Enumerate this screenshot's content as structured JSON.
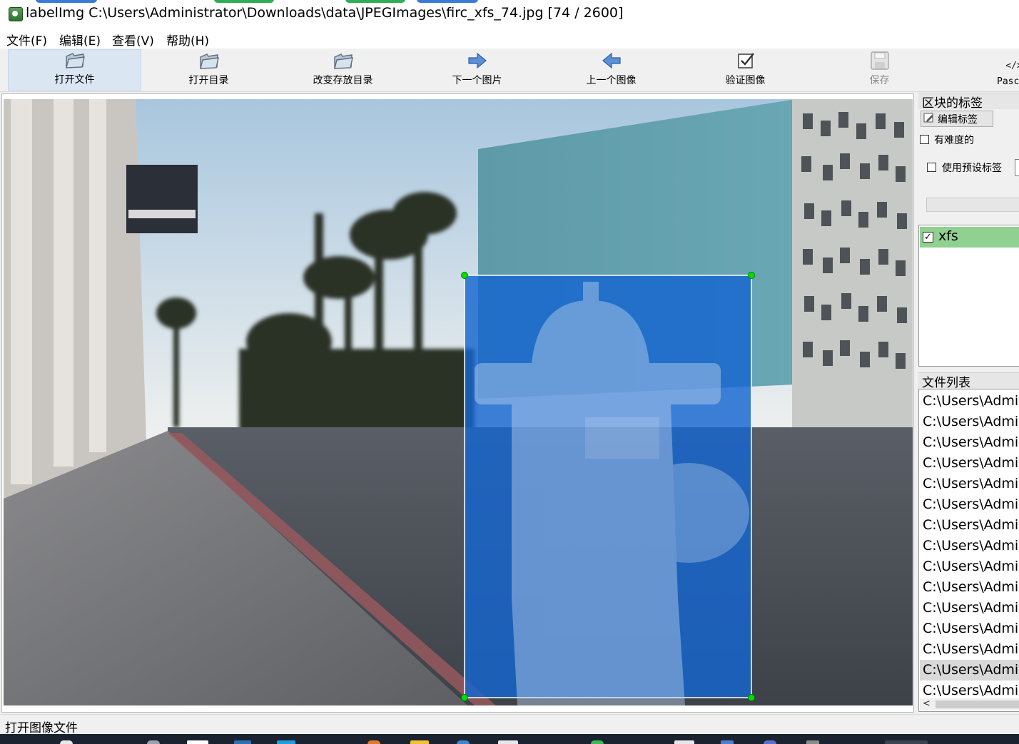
{
  "window": {
    "title": "labelImg C:\\Users\\Administrator\\Downloads\\data\\JPEGImages\\firc_xfs_74.jpg [74 / 2600]"
  },
  "menu": {
    "file": "文件(F)",
    "edit": "编辑(E)",
    "view": "查看(V)",
    "help": "帮助(H)"
  },
  "toolbar": {
    "open_file": "打开文件",
    "open_dir": "打开目录",
    "change_save_dir": "改变存放目录",
    "next_image": "下一个图片",
    "prev_image": "上一个图像",
    "verify_image": "验证图像",
    "save": "保存",
    "format": "Pascal"
  },
  "box_labels_panel": {
    "title": "区块的标签",
    "edit_label": "编辑标签",
    "difficult": "有难度的",
    "use_default_label": "使用预设标签",
    "labels": [
      {
        "text": "xfs",
        "checked": true
      }
    ]
  },
  "file_list_panel": {
    "title": "文件列表",
    "files": [
      "C:\\Users\\Administrator",
      "C:\\Users\\Administrator",
      "C:\\Users\\Administrator",
      "C:\\Users\\Administrator",
      "C:\\Users\\Administrator",
      "C:\\Users\\Administrator",
      "C:\\Users\\Administrator",
      "C:\\Users\\Administrator",
      "C:\\Users\\Administrator",
      "C:\\Users\\Administrator",
      "C:\\Users\\Administrator",
      "C:\\Users\\Administrator",
      "C:\\Users\\Administrator",
      "C:\\Users\\Administrator",
      "C:\\Users\\Administrator"
    ],
    "selected_index": 13
  },
  "annotation": {
    "label": "xfs",
    "fill_color": "#1565d0",
    "outline_color": "#ffffff",
    "vertex_color": "#00e000"
  },
  "status": {
    "text": "打开图像文件"
  },
  "colors": {
    "selected_label_bg": "#90d090",
    "toolbar_active_bg": "#dbe6f3"
  }
}
